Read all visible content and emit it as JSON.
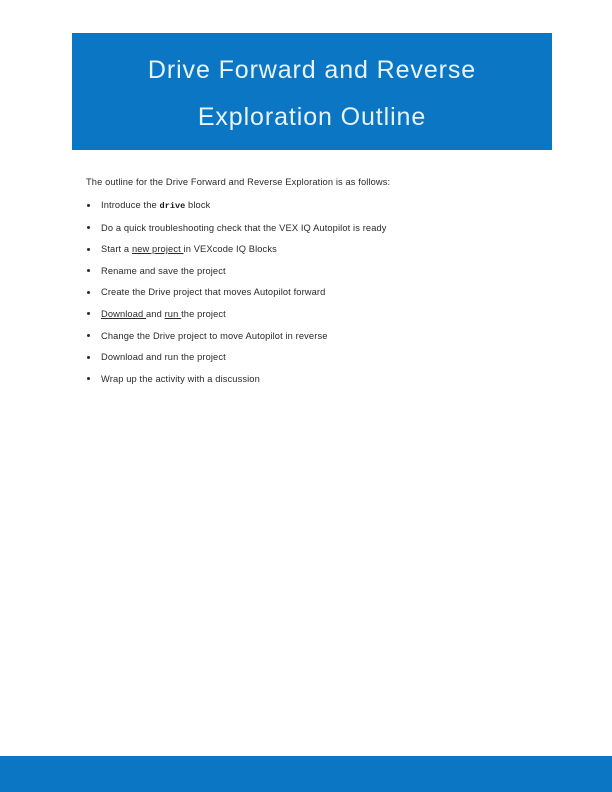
{
  "document": {
    "title_line_1": "Drive Forward and Reverse",
    "title_line_2": "Exploration Outline",
    "intro": "The outline for the Drive Forward and Reverse Exploration is as follows:",
    "outline_items": [
      {
        "segments": [
          {
            "text": "Introduce the ",
            "style": "plain"
          },
          {
            "text": "drive",
            "style": "code"
          },
          {
            "text": " block",
            "style": "plain"
          }
        ]
      },
      {
        "segments": [
          {
            "text": "Do a quick troubleshooting check that the VEX IQ Autopilot is ready",
            "style": "plain"
          }
        ]
      },
      {
        "segments": [
          {
            "text": "Start a ",
            "style": "plain"
          },
          {
            "text": "new project ",
            "style": "link"
          },
          {
            "text": "in VEXcode IQ Blocks",
            "style": "plain"
          }
        ]
      },
      {
        "segments": [
          {
            "text": "Rename and save the project",
            "style": "plain"
          }
        ]
      },
      {
        "segments": [
          {
            "text": "Create the Drive project that moves Autopilot forward",
            "style": "plain"
          }
        ]
      },
      {
        "segments": [
          {
            "text": "Download ",
            "style": "link"
          },
          {
            "text": "and ",
            "style": "plain"
          },
          {
            "text": "run ",
            "style": "link"
          },
          {
            "text": "the project",
            "style": "plain"
          }
        ]
      },
      {
        "segments": [
          {
            "text": "Change the Drive project to move Autopilot in reverse",
            "style": "plain"
          }
        ]
      },
      {
        "segments": [
          {
            "text": "Download and run the project",
            "style": "plain"
          }
        ]
      },
      {
        "segments": [
          {
            "text": "Wrap up the activity with a discussion",
            "style": "plain"
          }
        ]
      }
    ]
  },
  "theme": {
    "banner_color": "#0b76c4",
    "footer_color": "#0b76c4",
    "title_text_color": "#e8f4fb",
    "body_text_color": "#2a2a2a",
    "page_background": "#ffffff"
  }
}
